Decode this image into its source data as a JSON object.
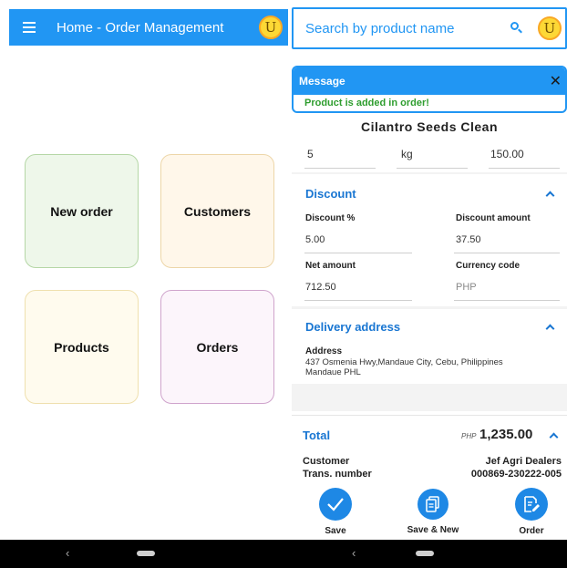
{
  "left": {
    "appbar": {
      "title": "Home - Order Management",
      "avatar_letter": "U"
    },
    "tiles": [
      {
        "label": "New order"
      },
      {
        "label": "Customers"
      },
      {
        "label": "Products"
      },
      {
        "label": "Orders"
      }
    ]
  },
  "right": {
    "search": {
      "placeholder": "Search by product name",
      "avatar_letter": "U"
    },
    "message": {
      "title": "Message",
      "text": "Product is added in order!",
      "close_glyph": "✕"
    },
    "product": {
      "name": "Cilantro Seeds Clean",
      "quantity": "5",
      "unit": "kg",
      "price": "150.00"
    },
    "discount": {
      "title": "Discount",
      "discount_percent_label": "Discount %",
      "discount_percent": "5.00",
      "discount_amount_label": "Discount amount",
      "discount_amount": "37.50",
      "net_amount_label": "Net amount",
      "net_amount": "712.50",
      "currency_label": "Currency code",
      "currency": "PHP"
    },
    "delivery": {
      "title": "Delivery address",
      "address_label": "Address",
      "address_line1": "437 Osmenia Hwy,Mandaue City, Cebu, Philippines",
      "address_line2": "Mandaue   PHL"
    },
    "total": {
      "title": "Total",
      "currency": "PHP",
      "amount": "1,235.00",
      "customer_label": "Customer",
      "customer": "Jef Agri Dealers",
      "trans_label": "Trans. number",
      "trans_number": "000869-230222-005"
    },
    "actions": [
      {
        "label": "Save"
      },
      {
        "label": "Save & New"
      },
      {
        "label": "Order"
      }
    ]
  },
  "navbar": {
    "back_glyph": "‹"
  },
  "colors": {
    "primary": "#2196F3",
    "success_text": "#2e9d2e",
    "avatar": "#FDD835"
  }
}
